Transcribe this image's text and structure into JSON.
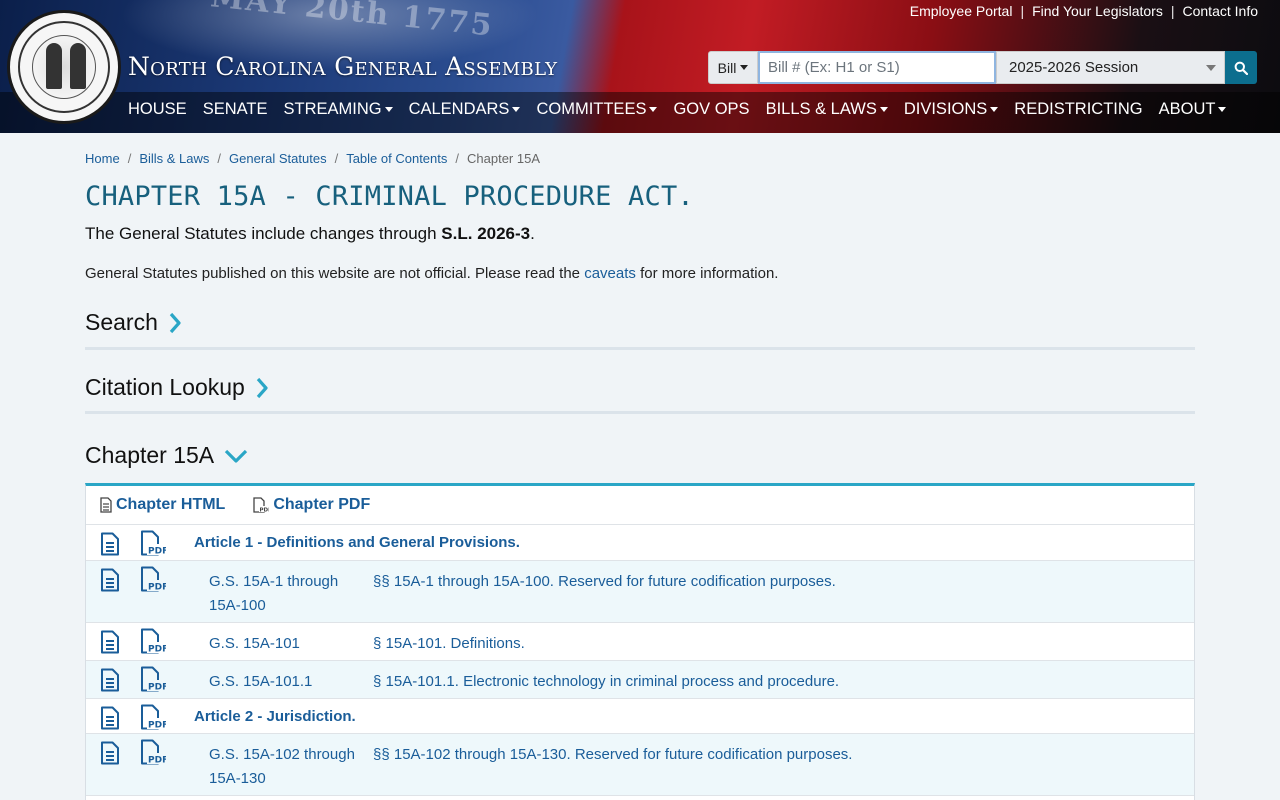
{
  "header": {
    "banner_text": "MAY 20th 1775",
    "site_title": "North Carolina General Assembly",
    "util_links": [
      "Employee Portal",
      "Find Your Legislators",
      "Contact Info"
    ],
    "search": {
      "type_label": "Bill",
      "placeholder": "Bill # (Ex: H1 or S1)",
      "session": "2025-2026 Session"
    },
    "nav": [
      {
        "label": "HOUSE",
        "dropdown": false
      },
      {
        "label": "SENATE",
        "dropdown": false
      },
      {
        "label": "STREAMING",
        "dropdown": true
      },
      {
        "label": "CALENDARS",
        "dropdown": true
      },
      {
        "label": "COMMITTEES",
        "dropdown": true
      },
      {
        "label": "GOV OPS",
        "dropdown": false
      },
      {
        "label": "BILLS & LAWS",
        "dropdown": true
      },
      {
        "label": "DIVISIONS",
        "dropdown": true
      },
      {
        "label": "REDISTRICTING",
        "dropdown": false
      },
      {
        "label": "ABOUT",
        "dropdown": true
      }
    ]
  },
  "breadcrumb": [
    "Home",
    "Bills & Laws",
    "General Statutes",
    "Table of Contents",
    "Chapter 15A"
  ],
  "page": {
    "title": "CHAPTER 15A - CRIMINAL PROCEDURE ACT.",
    "changes_prefix": "The General Statutes include changes through ",
    "changes_value": "S.L. 2026-3",
    "changes_suffix": ".",
    "disclaimer_prefix": "General Statutes published on this website are not official. Please read the ",
    "disclaimer_link": "caveats",
    "disclaimer_suffix": " for more information."
  },
  "sections": {
    "search": "Search",
    "citation": "Citation Lookup",
    "chapter": "Chapter 15A"
  },
  "panel": {
    "html_link": "Chapter HTML",
    "pdf_link": "Chapter PDF",
    "rows": [
      {
        "article": "Article 1 - Definitions and General Provisions."
      },
      {
        "gs": "G.S. 15A-1 through 15A-100",
        "desc": "§§ 15A-1 through 15A-100. Reserved for future codification purposes."
      },
      {
        "gs": "G.S. 15A-101",
        "desc": "§ 15A-101. Definitions."
      },
      {
        "gs": "G.S. 15A-101.1",
        "desc": "§ 15A-101.1. Electronic technology in criminal process and procedure."
      },
      {
        "article": "Article 2 - Jurisdiction."
      },
      {
        "gs": "G.S. 15A-102 through 15A-130",
        "desc": "§§ 15A-102 through 15A-130. Reserved for future codification purposes."
      }
    ]
  },
  "colors": {
    "link": "#1a5d99",
    "title": "#17607d",
    "accent": "#2aa6c6",
    "search_button": "#0c6e8e"
  }
}
